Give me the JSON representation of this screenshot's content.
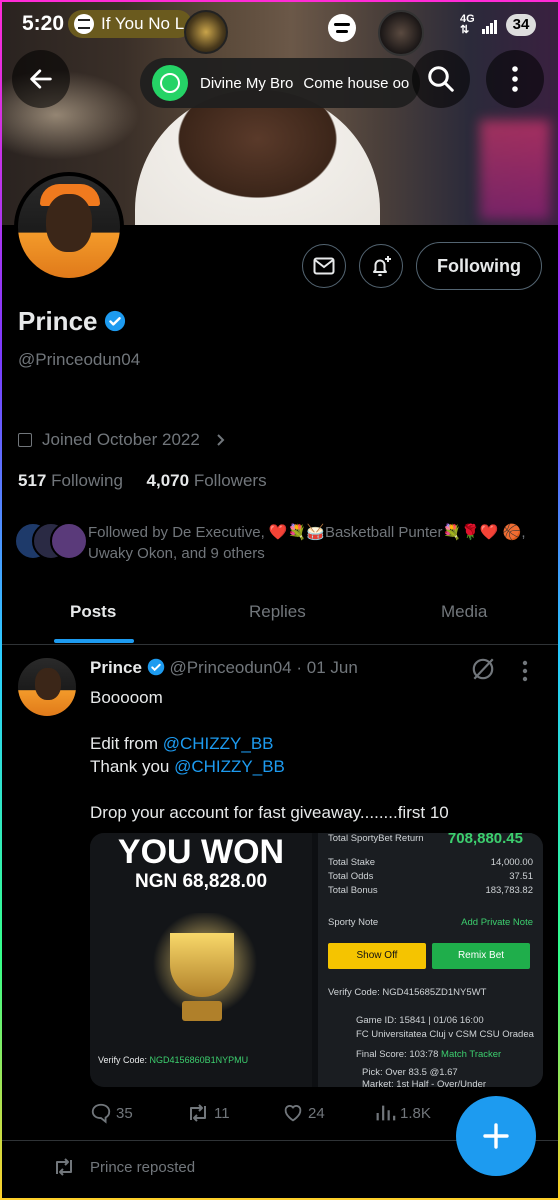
{
  "status_bar": {
    "time": "5:20",
    "media_title": "If You No L",
    "network": "4G",
    "battery": "34"
  },
  "notification": {
    "app": "whatsapp-icon",
    "sender": "Divine My Bro",
    "message": "Come house oo"
  },
  "profile": {
    "name": "Prince",
    "handle": "@Princeodun04",
    "follow_label": "Following",
    "joined": "Joined October 2022",
    "following_count": "517",
    "following_label": "Following",
    "followers_count": "4,070",
    "followers_label": "Followers",
    "followed_by": "Followed by De Executive, ❤️💐🥁Basketball Punter💐🌹❤️ 🏀, Uwaky Okon, and 9 others"
  },
  "tabs": [
    "Posts",
    "Replies",
    "Media"
  ],
  "post": {
    "author": "Prince",
    "handle": "@Princeodun04",
    "date": "· 01 Jun",
    "line1": "Booooom",
    "line2_prefix": "Edit from ",
    "mention": "@CHIZZY_BB",
    "line3_prefix": "Thank you ",
    "line4": "Drop your account for fast giveaway........first 10",
    "media": {
      "won_title": "YOU WON",
      "won_amount": "NGN 68,828.00",
      "verify_left": "Verify Code:",
      "verify_left_code": "NGD4156860B1NYPMU",
      "return_label": "Total SportyBet Return",
      "return_value": "708,880.45",
      "rows": [
        {
          "label": "Total Stake",
          "value": "14,000.00"
        },
        {
          "label": "Total Odds",
          "value": "37.51"
        },
        {
          "label": "Total Bonus",
          "value": "183,783.82"
        }
      ],
      "sporty_note": "Sporty Note",
      "add_note": "Add Private Note",
      "show_off": "Show Off",
      "remix_bet": "Remix Bet",
      "verify_right": "Verify Code: NGD415685ZD1NY5WT",
      "game_id": "Game ID: 15841 | 01/06 16:00",
      "match": "FC Universitatea Cluj v CSM CSU Oradea",
      "final_score": "Final Score: 103:78",
      "match_tracker": "Match Tracker",
      "pick": "Pick: Over 83.5 @1.67",
      "market": "Market: 1st Half - Over/Under"
    },
    "replies": "35",
    "reposts": "11",
    "likes": "24",
    "views": "1.8K"
  },
  "next_item": {
    "repost_text": "Prince reposted"
  },
  "colors": {
    "accent": "#1d9bf0",
    "background": "#000000",
    "muted": "#71767b"
  }
}
